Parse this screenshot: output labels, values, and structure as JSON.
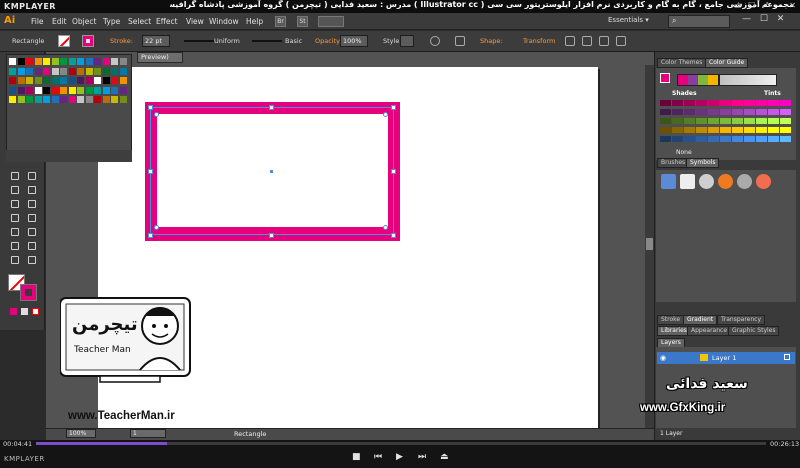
{
  "player": {
    "brand_top": "KMPLAYER",
    "window_controls": "▭ ☐ ⤢ — ✕",
    "course_title": "مجموعه آموزشی جامع ، گام به گام و کاربردی نرم افزار ایلوستریتور سی سی ( Illustrator cc )   مدرس : سعید فدایی ( تیچرمن ) گروه آموزشی پادشاه گرافیست ها",
    "time_elapsed": "00:04:41",
    "time_total": "00:26:13",
    "progress_fraction": 0.179,
    "brand_bottom": "KMPLAYER",
    "controls": [
      "■",
      "⏮",
      "▶",
      "⏭",
      "⏏"
    ]
  },
  "app": {
    "logo": "Ai",
    "menu": [
      "File",
      "Edit",
      "Object",
      "Type",
      "Select",
      "Effect",
      "View",
      "Window",
      "Help"
    ],
    "bridge_chip": "Br",
    "stock_chip": "St",
    "workspace": "Essentials ▾",
    "window_controls": "— ☐ ✕"
  },
  "control_bar": {
    "object_type": "Rectangle",
    "stroke_label": "Stroke:",
    "stroke_weight": "22 pt",
    "profile": "Uniform",
    "brush": "Basic",
    "opacity_label": "Opacity:",
    "opacity_value": "100%",
    "style_label": "Style:",
    "shape_label": "Shape:",
    "transform_label": "Transform"
  },
  "document": {
    "tab_label": "Preview)",
    "zoom": "100%",
    "page": "1",
    "status_tool": "Rectangle"
  },
  "panels": {
    "color_themes_tab": "Color Themes",
    "color_guide_tab": "Color Guide",
    "shades_label": "Shades",
    "tints_label": "Tints",
    "none_label": "None",
    "brushes_tab": "Brushes",
    "symbols_tab": "Symbols",
    "stroke_tab": "Stroke",
    "gradient_tab": "Gradient",
    "transparency_tab": "Transparency",
    "libraries_tab": "Libraries",
    "appearance_tab": "Appearance",
    "graphic_styles_tab": "Graphic Styles",
    "layers_tab": "Layers",
    "layer_name": "Layer 1",
    "layer_count": "1 Layer"
  },
  "colors": {
    "accent_magenta": "#e6007e",
    "selection_blue": "#4a8fe0",
    "ai_orange": "#ff9a00"
  },
  "watermarks": {
    "teacherman_url": "www.TeacherMan.ir",
    "teacherman_label": "Teacher Man",
    "gfxking_url": "www.GfxKing.ir",
    "author_name": "سعید فدائی"
  }
}
